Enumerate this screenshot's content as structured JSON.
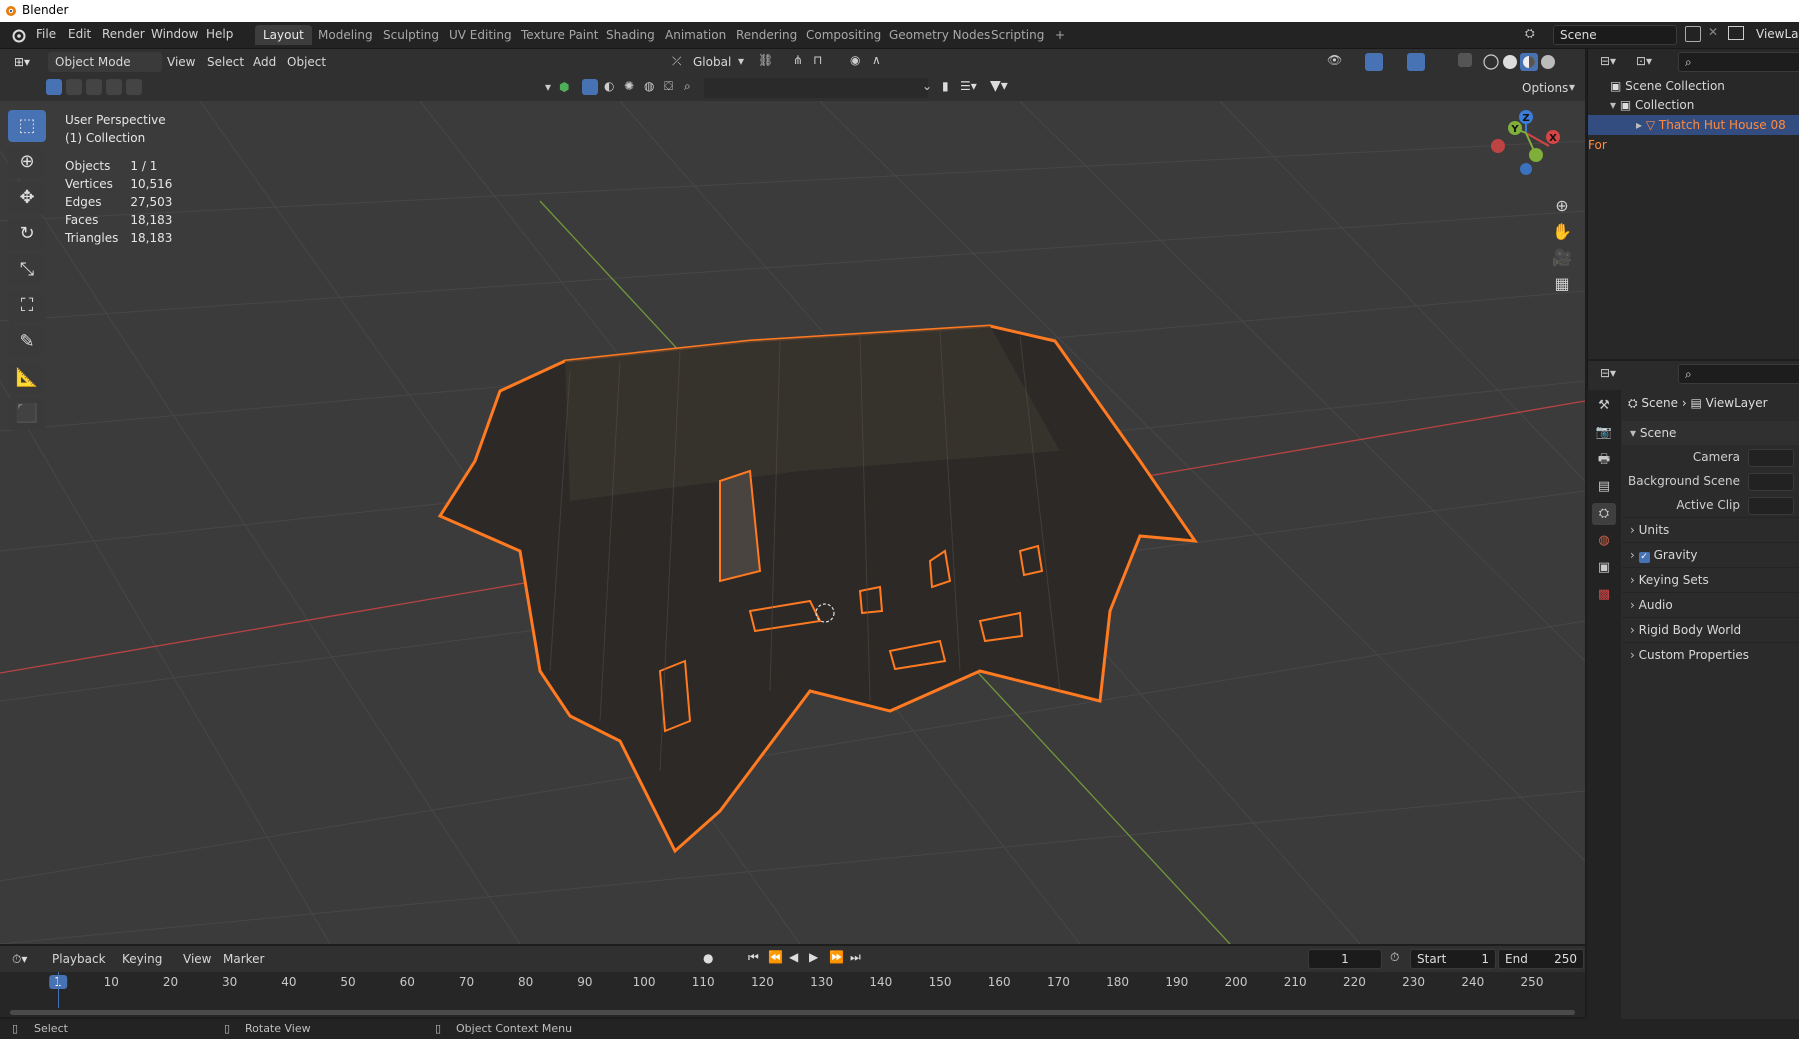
{
  "window": {
    "title": "Blender"
  },
  "menu": [
    "File",
    "Edit",
    "Render",
    "Window",
    "Help"
  ],
  "workspaces": [
    "Layout",
    "Modeling",
    "Sculpting",
    "UV Editing",
    "Texture Paint",
    "Shading",
    "Animation",
    "Rendering",
    "Compositing",
    "Geometry Nodes",
    "Scripting",
    "+"
  ],
  "active_workspace": "Layout",
  "scene_field": "Scene",
  "viewlayer_field": "ViewLay",
  "viewport_header": {
    "mode": "Object Mode",
    "menus": [
      "View",
      "Select",
      "Add",
      "Object"
    ],
    "transform_orientation": "Global",
    "options_label": "Options"
  },
  "overlay_text": {
    "perspective": "User Perspective",
    "collection": "(1) Collection"
  },
  "stats": [
    {
      "label": "Objects",
      "value": "1 / 1"
    },
    {
      "label": "Vertices",
      "value": "10,516"
    },
    {
      "label": "Edges",
      "value": "27,503"
    },
    {
      "label": "Faces",
      "value": "18,183"
    },
    {
      "label": "Triangles",
      "value": "18,183"
    }
  ],
  "tools": [
    "select-box",
    "cursor",
    "move",
    "rotate",
    "scale",
    "transform",
    "annotate",
    "measure",
    "add-cube"
  ],
  "tool_icons": [
    "⬚",
    "⊕",
    "✥",
    "↻",
    "⤡",
    "⛶",
    "✎",
    "📐",
    "⬛"
  ],
  "nav_gizmo": {
    "z": "Z",
    "y": "Y",
    "x": "X"
  },
  "outliner": {
    "root": "Scene Collection",
    "collection": "Collection",
    "object": "Thatch Hut House 08 For"
  },
  "properties": {
    "breadcrumb_scene": "Scene",
    "breadcrumb_viewlayer": "ViewLayer",
    "section": "Scene",
    "fields": [
      {
        "label": "Camera"
      },
      {
        "label": "Background Scene"
      },
      {
        "label": "Active Clip"
      }
    ],
    "subsections": [
      {
        "label": "Units",
        "checkbox": false
      },
      {
        "label": "Gravity",
        "checkbox": true
      },
      {
        "label": "Keying Sets",
        "checkbox": false
      },
      {
        "label": "Audio",
        "checkbox": false
      },
      {
        "label": "Rigid Body World",
        "checkbox": false
      },
      {
        "label": "Custom Properties",
        "checkbox": false
      }
    ]
  },
  "timeline": {
    "menus": [
      "Playback",
      "Keying",
      "View",
      "Marker"
    ],
    "current_frame": "1",
    "start_label": "Start",
    "start_value": "1",
    "end_label": "End",
    "end_value": "250",
    "ticks": [
      "1",
      "10",
      "20",
      "30",
      "40",
      "50",
      "60",
      "70",
      "80",
      "90",
      "100",
      "110",
      "120",
      "130",
      "140",
      "150",
      "160",
      "170",
      "180",
      "190",
      "200",
      "210",
      "220",
      "230",
      "240",
      "250"
    ]
  },
  "statusbar": {
    "left": "Select",
    "middle": "Rotate View",
    "right": "Object Context Menu"
  },
  "colors": {
    "selection_outline": "#ff7a21",
    "accent_blue": "#4772b3",
    "axis_x": "#d64545",
    "axis_y": "#7fae3a",
    "axis_z": "#3b7dd8"
  }
}
